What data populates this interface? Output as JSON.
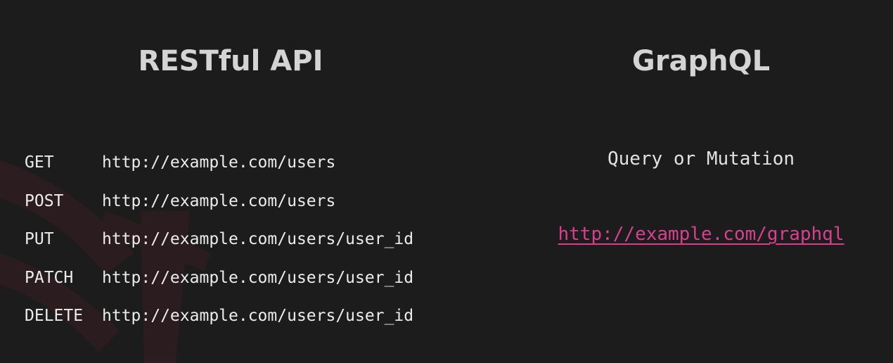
{
  "rest": {
    "title": "RESTful API",
    "endpoints": [
      {
        "method": "GET",
        "url": "http://example.com/users"
      },
      {
        "method": "POST",
        "url": "http://example.com/users"
      },
      {
        "method": "PUT",
        "url": "http://example.com/users/user_id"
      },
      {
        "method": "PATCH",
        "url": "http://example.com/users/user_id"
      },
      {
        "method": "DELETE",
        "url": "http://example.com/users/user_id"
      }
    ]
  },
  "graphql": {
    "title": "GraphQL",
    "operation": "Query or Mutation",
    "url": "http://example.com/graphql"
  },
  "colors": {
    "background": "#1c1c1c",
    "title": "#d4d4d4",
    "text": "#ececec",
    "link": "#d8408e",
    "accent_shape": "#3a2228"
  }
}
